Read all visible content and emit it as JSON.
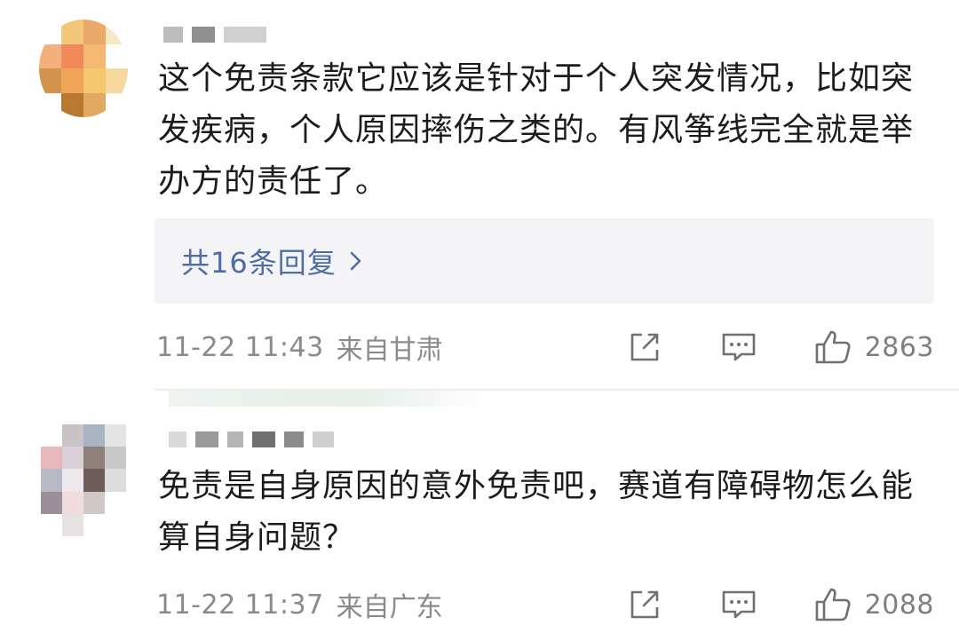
{
  "comments": [
    {
      "avatar_colors": [
        "#ffffff",
        "#f3c77a",
        "#eaa869",
        "#f8e7c4",
        "#f2b07d",
        "#f08a5d",
        "#f4b870",
        "#ffffff",
        "#d2934e",
        "#f0a45a",
        "#f6c86e",
        "#f7d9a0",
        "#ffffff",
        "#b8782f",
        "#e0a860",
        "#ffffff"
      ],
      "name_mosaic_colors": [
        "#bdbdbd",
        "#8f8f8f",
        "#d0d0d0"
      ],
      "text": "这个免责条款它应该是针对于个人突发情况，比如突发疾病，个人原因摔伤之类的。有风筝线完全就是举办方的责任了。",
      "replies_label": "共16条回复",
      "time": "11-22 11:43",
      "location": "来自甘肃",
      "likes": "2863"
    },
    {
      "avatar_colors": [
        "#ffffff",
        "#c9c2c6",
        "#a7b4c3",
        "#e4e4e4",
        "#e7b9bd",
        "#d9d0d8",
        "#8e7f7a",
        "#c8c8c8",
        "#b8b8c4",
        "#ece8ec",
        "#6e5b5a",
        "#dcdcdc",
        "#9b8f9a",
        "#f0dcdc",
        "#cfc8c8",
        "#ffffff",
        "#ffffff",
        "#e7e2e2",
        "#ffffff",
        "#ffffff"
      ],
      "name_mosaic_colors": [
        "#d9d9d9",
        "#9a9a9a",
        "#b5b5b5",
        "#707070",
        "#8c8c8c",
        "#cfcfcf"
      ],
      "text": "免责是自身原因的意外免责吧，赛道有障碍物怎么能算自身问题？",
      "time": "11-22 11:37",
      "location": "来自广东",
      "likes": "2088"
    }
  ],
  "colors": {
    "reply_link": "#4e6ea3",
    "meta_text": "#8a8a8a",
    "icon_stroke": "#707070"
  },
  "icons": [
    "share-icon",
    "comment-icon",
    "like-icon",
    "chevron-right-icon"
  ]
}
